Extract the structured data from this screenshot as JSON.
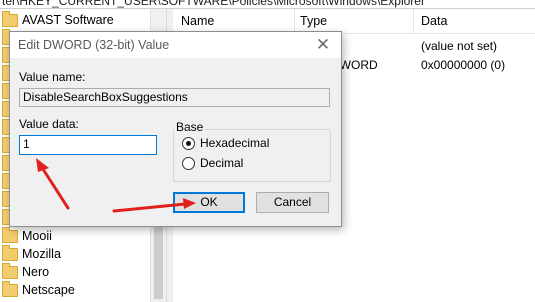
{
  "address_bar": {
    "path": "ter\\HKEY_CURRENT_USER\\SOFTWARE\\Policies\\Microsoft\\Windows\\Explorer"
  },
  "tree": {
    "items": [
      {
        "label": "AVAST Software"
      },
      {
        "label": ""
      },
      {
        "label": ""
      },
      {
        "label": ""
      },
      {
        "label": ""
      },
      {
        "label": ""
      },
      {
        "label": ""
      },
      {
        "label": ""
      },
      {
        "label": ""
      },
      {
        "label": ""
      },
      {
        "label": ""
      },
      {
        "label": ""
      },
      {
        "label": "Mooii"
      },
      {
        "label": "Mozilla"
      },
      {
        "label": "Nero"
      },
      {
        "label": "Netscape"
      }
    ]
  },
  "list": {
    "columns": [
      "Name",
      "Type",
      "Data"
    ],
    "rows": [
      {
        "type": "Z",
        "data": "(value not set)"
      },
      {
        "type": "DWORD",
        "data": "0x00000000 (0)"
      }
    ]
  },
  "dialog": {
    "title": "Edit DWORD (32-bit) Value",
    "close_glyph": "✕",
    "value_name_label": "Value name:",
    "value_name": "DisableSearchBoxSuggestions",
    "value_data_label": "Value data:",
    "value_data": "1",
    "base_label": "Base",
    "base_options": [
      {
        "label": "Hexadecimal",
        "checked": true
      },
      {
        "label": "Decimal",
        "checked": false
      }
    ],
    "ok_label": "OK",
    "cancel_label": "Cancel"
  },
  "annotations": {
    "arrow_color": "#e0201b"
  }
}
